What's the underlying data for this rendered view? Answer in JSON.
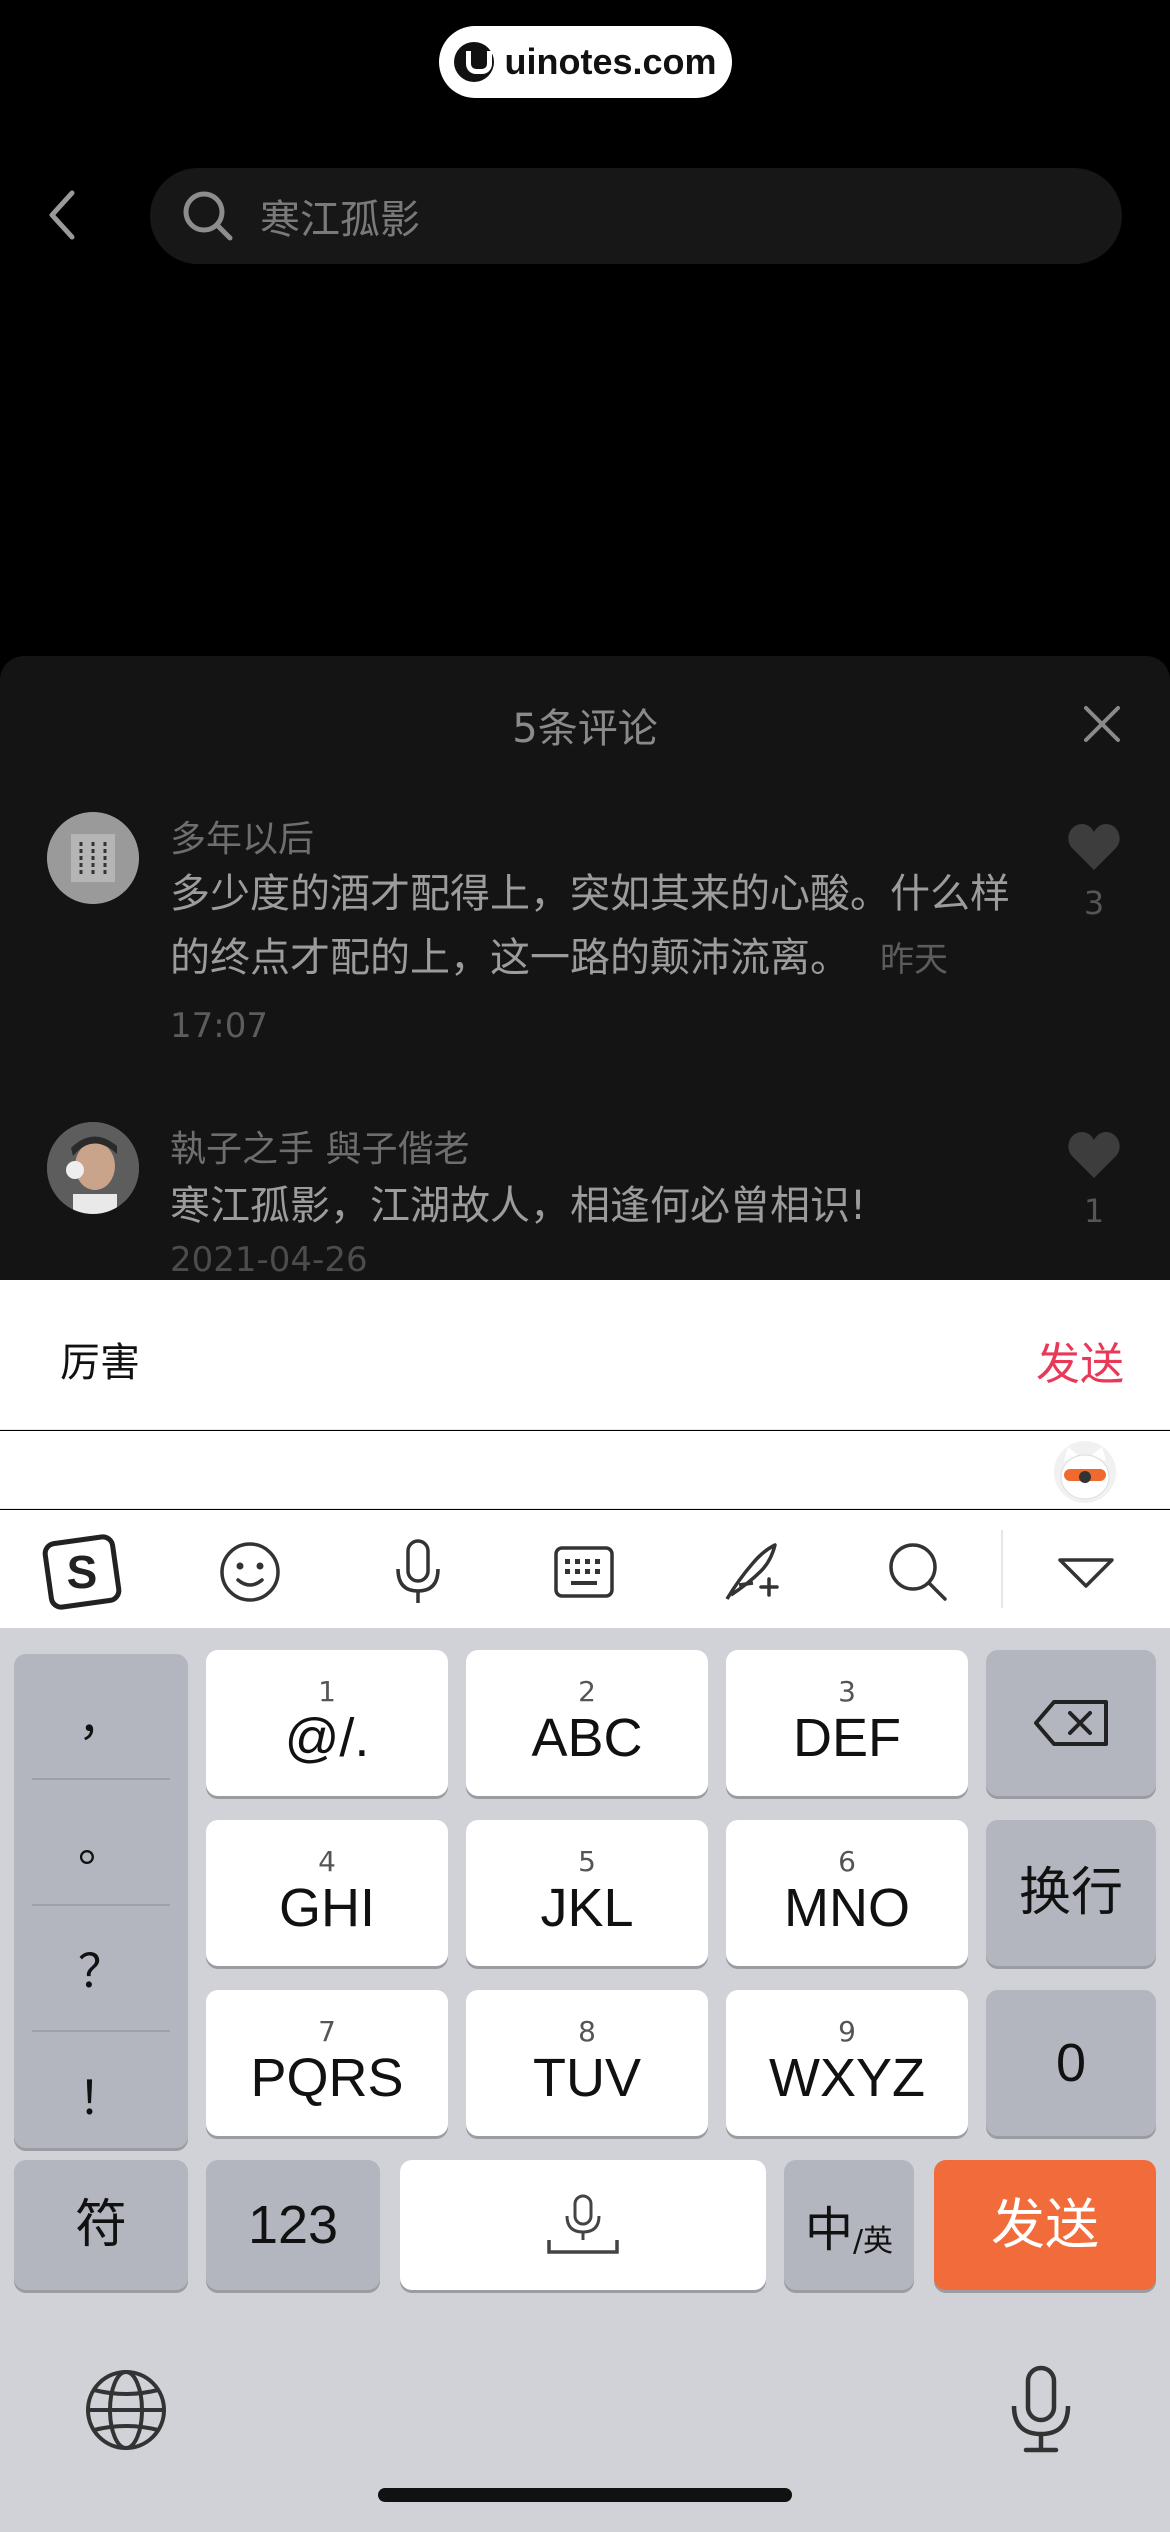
{
  "watermark": {
    "text": "uinotes.com"
  },
  "search": {
    "query": "寒江孤影"
  },
  "sheet": {
    "title": "5条评论",
    "comments": [
      {
        "name": "多年以后",
        "text": "多少度的酒才配得上，突如其来的心酸。什么样的终点才配的上，这一路的颠沛流离。",
        "time": "昨天 17:07",
        "likes": "3"
      },
      {
        "name": "執子之手 與子偕老",
        "text": "寒江孤影，江湖故人，相逢何必曾相识!",
        "time": "2021-04-26",
        "likes": "1"
      }
    ]
  },
  "input": {
    "value": "厉害",
    "send_label": "发送"
  },
  "ime": {
    "toolbar_icons": [
      "sogou-logo-icon",
      "emoji-icon",
      "microphone-icon",
      "keyboard-icon",
      "handwriting-icon",
      "search-icon",
      "collapse-icon"
    ],
    "punctuation": [
      "，",
      "。",
      "？",
      "！"
    ],
    "keys": [
      {
        "num": "1",
        "label": "@/."
      },
      {
        "num": "2",
        "label": "ABC"
      },
      {
        "num": "3",
        "label": "DEF"
      },
      {
        "num": "4",
        "label": "GHI"
      },
      {
        "num": "5",
        "label": "JKL"
      },
      {
        "num": "6",
        "label": "MNO"
      },
      {
        "num": "7",
        "label": "PQRS"
      },
      {
        "num": "8",
        "label": "TUV"
      },
      {
        "num": "9",
        "label": "WXYZ"
      }
    ],
    "newline_label": "换行",
    "zero_label": "0",
    "symbol_label": "符",
    "num_label": "123",
    "lang_main": "中",
    "lang_sub": "/英",
    "send_label": "发送",
    "send_color": "#f26b3a",
    "accent_color": "#e83a58"
  }
}
